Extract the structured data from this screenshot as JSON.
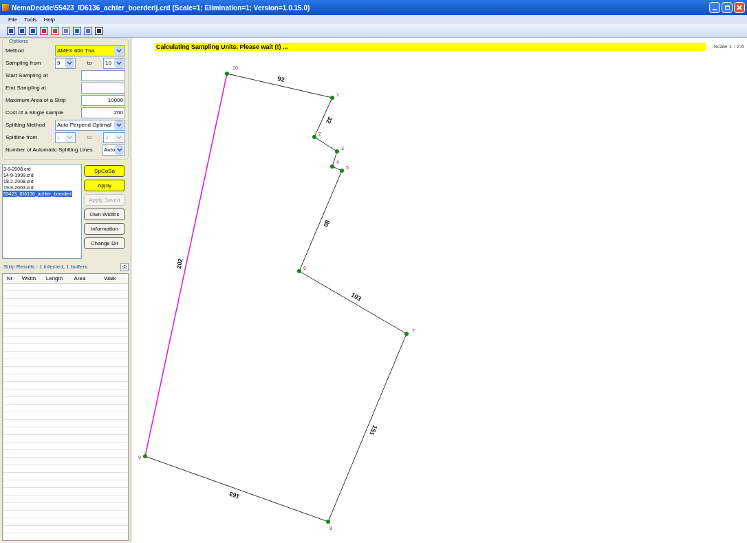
{
  "window": {
    "title": "NemaDecide\\55423_ID6136_achter_boerderij.crd  (Scale=1; Elimination=1; Version=1.0.15.0)"
  },
  "menu": [
    "File",
    "Tools",
    "Help"
  ],
  "options": {
    "title": "Options",
    "rows": [
      {
        "kind": "select",
        "label": "Method",
        "value": "AMEX 600 Tha",
        "highlighted": true
      },
      {
        "kind": "range",
        "label": "Sampling from",
        "from": "9",
        "to_label": "to",
        "to": "10",
        "disabled": false
      },
      {
        "kind": "input",
        "label": "Start Sampling at"
      },
      {
        "kind": "input",
        "label": "End Sampling at"
      },
      {
        "kind": "input",
        "label": "Maximum Area of a Strip",
        "value": "10000"
      },
      {
        "kind": "input",
        "label": "Cost of a Single sample",
        "value": "200"
      },
      {
        "kind": "select",
        "label": "Splitting Method",
        "value": "Auto Perpend Optimal",
        "highlighted": false
      },
      {
        "kind": "range",
        "label": "Splitline from",
        "from": "1",
        "to_label": "to",
        "to": "3",
        "disabled": true
      },
      {
        "kind": "small_select",
        "label": "Number of Automatic Splitting Lines",
        "value": "Auto"
      }
    ]
  },
  "files": [
    {
      "name": "3-9-2008.crd",
      "selected": false
    },
    {
      "name": "14-9-1999.crd",
      "selected": false
    },
    {
      "name": "18-2-2008.crd",
      "selected": false
    },
    {
      "name": "19-9-2003.crd",
      "selected": false
    },
    {
      "name": "55423_ID6136_achter_boerderi",
      "selected": true
    }
  ],
  "buttons": [
    {
      "label": "SpCoSa",
      "highlighted": true,
      "disabled": false
    },
    {
      "label": "Apply",
      "highlighted": true,
      "disabled": false
    },
    {
      "label": "Apply Saved",
      "highlighted": false,
      "disabled": true
    },
    {
      "label": "Own Widths",
      "highlighted": false,
      "disabled": false
    },
    {
      "label": "Information",
      "highlighted": false,
      "disabled": false
    },
    {
      "label": "Change Dir",
      "highlighted": false,
      "disabled": false
    }
  ],
  "strip_results": {
    "title": "Strip Results : 1 infected,  1 buffers",
    "columns": [
      "Nr",
      "Width",
      "Length",
      "Area",
      "Walk"
    ]
  },
  "canvas": {
    "status": "Calculating Sampling Units.   Please wait (!) ...",
    "scale": "Scale 1 : 2.6",
    "vertices": [
      "10",
      "1",
      "2",
      "3",
      "4",
      "5",
      "6",
      "7",
      "8",
      "9"
    ],
    "edges": [
      {
        "label": "92",
        "highlighted": false
      },
      {
        "label": "32",
        "highlighted": false
      },
      {
        "highlighted": false
      },
      {
        "highlighted": false
      },
      {
        "highlighted": false
      },
      {
        "label": "80",
        "highlighted": false
      },
      {
        "label": "103",
        "highlighted": false
      },
      {
        "label": "151",
        "highlighted": false
      },
      {
        "label": "163",
        "highlighted": false
      },
      {
        "label": "202",
        "highlighted": true
      }
    ]
  }
}
